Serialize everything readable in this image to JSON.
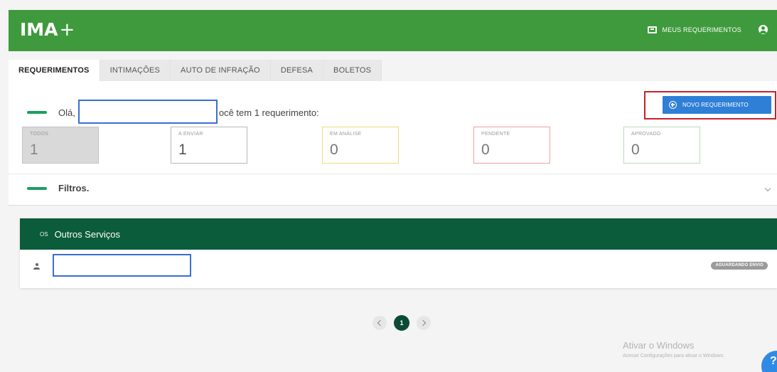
{
  "app": {
    "logo_text": "IMA",
    "logo_plus": "+",
    "header_link": "MEUS REQUERIMENTOS",
    "icons": {
      "requerimentos": "id-card-icon",
      "user": "user-circle-icon"
    },
    "colors": {
      "header": "#3e9a3c",
      "dark_green": "#0b5c3a",
      "primary": "#2f7fd6",
      "highlight_red": "#c8202a"
    }
  },
  "tabs": [
    {
      "label": "REQUERIMENTOS",
      "active": true
    },
    {
      "label": "INTIMAÇÕES",
      "active": false
    },
    {
      "label": "AUTO DE INFRAÇÃO",
      "active": false
    },
    {
      "label": "DEFESA",
      "active": false
    },
    {
      "label": "BOLETOS",
      "active": false
    }
  ],
  "greeting": {
    "prefix": "Olá,",
    "suffix": "ocê tem 1 requerimento:"
  },
  "new_button": {
    "label": "NOVO REQUERIMENTO",
    "icon": "plus-circle-icon"
  },
  "stats": [
    {
      "label": "TODOS",
      "value": "1",
      "color": "#c4c4c4"
    },
    {
      "label": "A ENVIAR",
      "value": "1",
      "color": "#b8b8b8"
    },
    {
      "label": "EM ANÁLISE",
      "value": "0",
      "color": "#f0dc7a"
    },
    {
      "label": "PENDENTE",
      "value": "0",
      "color": "#ef9f9f"
    },
    {
      "label": "APROVADO",
      "value": "0",
      "color": "#b7dcb7"
    }
  ],
  "filters": {
    "label": "Filtros."
  },
  "outros": {
    "prefix": "OS",
    "title": "Outros Serviços",
    "row_status": "AGUARDANDO ENVIO"
  },
  "pagination": {
    "current": "1"
  },
  "watermark": {
    "title": "Ativar o Windows",
    "subtitle": "Acesse Configurações para ativar o Windows."
  },
  "help_fab": "?"
}
